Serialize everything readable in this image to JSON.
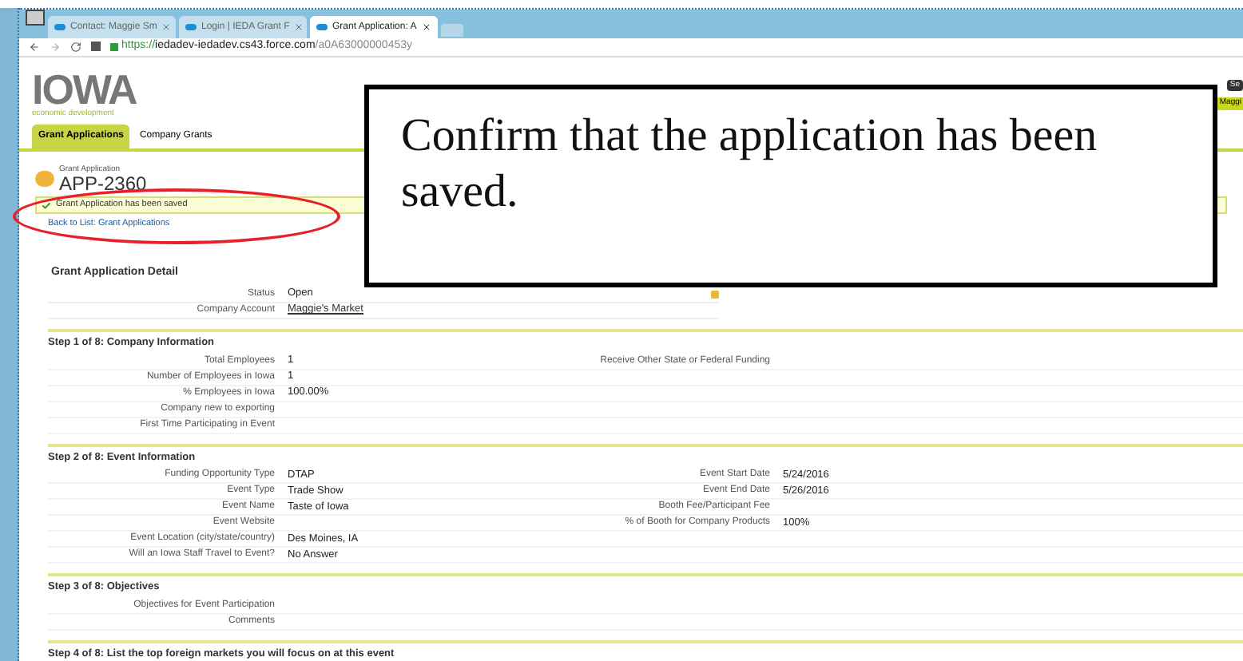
{
  "browser": {
    "tabs": [
      {
        "label": "Contact: Maggie Sm",
        "selected": false
      },
      {
        "label": "Login | IEDA Grant F",
        "selected": false
      },
      {
        "label": "Grant Application: A",
        "selected": true
      }
    ],
    "url_scheme": "https://",
    "url_domain": "iedadev-iedadev.cs43.force.com",
    "url_path": "/a0A63000000453y"
  },
  "header": {
    "logo": "IOWA",
    "logo_subtitle": "economic development",
    "user_button": "Se",
    "user_badge": "Maggi"
  },
  "nav_tabs": [
    {
      "label": "Grant Applications",
      "selected": true
    },
    {
      "label": "Company Grants",
      "selected": false
    }
  ],
  "record": {
    "type_label": "Grant Application",
    "name": "APP-2360",
    "message": "Grant Application has been saved",
    "back_link": "Back to List: Grant Applications"
  },
  "detail": {
    "title": "Grant Application Detail",
    "top_rows": [
      {
        "label": "Status",
        "value": "Open",
        "kind": "text",
        "locked": true
      },
      {
        "label": "Company Account",
        "value": "Maggie's Market",
        "kind": "link",
        "locked": false
      }
    ],
    "sections": [
      {
        "title": "Step 1 of 8: Company Information",
        "rows": [
          {
            "left": {
              "label": "Total Employees",
              "value": "1"
            },
            "right": {
              "label": "Receive Other State or Federal Funding"
            }
          },
          {
            "left": {
              "label": "Number of Employees in Iowa",
              "value": "1"
            }
          },
          {
            "left": {
              "label": "% Employees in Iowa",
              "value": "100.00%"
            }
          },
          {
            "left": {
              "label": "Company new to exporting"
            }
          },
          {
            "left": {
              "label": "First Time Participating in Event"
            }
          }
        ]
      },
      {
        "title": "Step 2 of 8: Event Information",
        "rows": [
          {
            "left": {
              "label": "Funding Opportunity Type",
              "value": "DTAP"
            },
            "right": {
              "label": "Event Start Date",
              "value": "5/24/2016"
            }
          },
          {
            "left": {
              "label": "Event Type",
              "value": "Trade Show"
            },
            "right": {
              "label": "Event End Date",
              "value": "5/26/2016"
            }
          },
          {
            "left": {
              "label": "Event Name",
              "value": "Taste of Iowa"
            },
            "right": {
              "label": "Booth Fee/Participant Fee"
            }
          },
          {
            "left": {
              "label": "Event Website"
            },
            "right": {
              "label": "% of Booth for Company Products",
              "value": "100%"
            }
          },
          {
            "left": {
              "label": "Event Location (city/state/country)",
              "value": "Des Moines, IA"
            }
          },
          {
            "left": {
              "label": "Will an Iowa Staff Travel to Event?",
              "value": "No Answer"
            }
          }
        ]
      },
      {
        "title": "Step 3 of 8: Objectives",
        "rows": [
          {
            "left": {
              "label": "Objectives for Event Participation"
            }
          },
          {
            "left": {
              "label": "Comments"
            }
          }
        ]
      },
      {
        "title": "Step 4 of 8: List the top foreign markets you will focus on at this event"
      }
    ]
  },
  "callout": {
    "text": "Confirm that the application has been saved.",
    "highlight_ellipse": true
  }
}
